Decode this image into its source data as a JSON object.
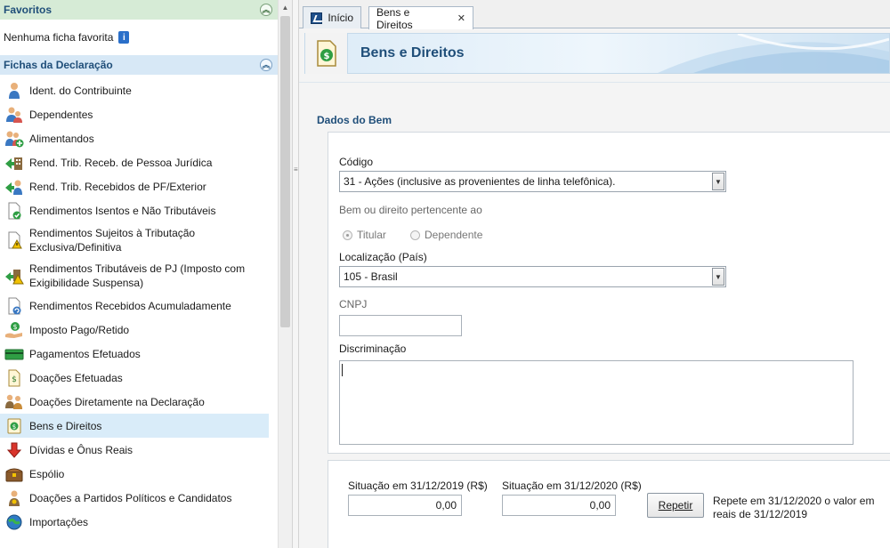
{
  "sidebar": {
    "favoritos": {
      "title": "Favoritos",
      "empty_text": "Nenhuma ficha favorita"
    },
    "fichas": {
      "title": "Fichas da Declaração",
      "items": [
        {
          "label": "Ident. do Contribuinte",
          "icon": "person-icon"
        },
        {
          "label": "Dependentes",
          "icon": "dependents-icon"
        },
        {
          "label": "Alimentandos",
          "icon": "alimentandos-icon"
        },
        {
          "label": "Rend. Trib. Receb. de Pessoa Jurídica",
          "icon": "pj-income-icon"
        },
        {
          "label": "Rend. Trib. Recebidos de PF/Exterior",
          "icon": "pf-income-icon"
        },
        {
          "label": "Rendimentos Isentos e Não Tributáveis",
          "icon": "exempt-income-icon"
        },
        {
          "label": "Rendimentos Sujeitos à Tributação Exclusiva/Definitiva",
          "icon": "exclusive-tax-icon"
        },
        {
          "label": "Rendimentos Tributáveis de PJ (Imposto com Exigibilidade Suspensa)",
          "icon": "suspended-tax-icon"
        },
        {
          "label": "Rendimentos Recebidos Acumuladamente",
          "icon": "accumulated-income-icon"
        },
        {
          "label": "Imposto Pago/Retido",
          "icon": "tax-paid-icon"
        },
        {
          "label": "Pagamentos Efetuados",
          "icon": "payments-icon"
        },
        {
          "label": "Doações Efetuadas",
          "icon": "donations-icon"
        },
        {
          "label": "Doações Diretamente na Declaração",
          "icon": "direct-donations-icon"
        },
        {
          "label": "Bens e Direitos",
          "icon": "assets-icon"
        },
        {
          "label": "Dívidas e Ônus Reais",
          "icon": "debts-icon"
        },
        {
          "label": "Espólio",
          "icon": "estate-icon"
        },
        {
          "label": "Doações a Partidos Políticos e Candidatos",
          "icon": "political-donations-icon"
        },
        {
          "label": "Importações",
          "icon": "imports-icon"
        }
      ]
    }
  },
  "tabs": [
    {
      "label": "Início"
    },
    {
      "label": "Bens e Direitos"
    }
  ],
  "page": {
    "title": "Bens e Direitos"
  },
  "form": {
    "section_title": "Dados do Bem",
    "codigo_label": "Código",
    "codigo_value": "31 - Ações (inclusive as provenientes de linha telefônica).",
    "pertencente_label": "Bem ou direito pertencente ao",
    "titular_label": "Titular",
    "dependente_label": "Dependente",
    "localizacao_label": "Localização (País)",
    "localizacao_value": "105 - Brasil",
    "cnpj_label": "CNPJ",
    "cnpj_value": "",
    "discriminacao_label": "Discriminação",
    "sit2019_label": "Situação em 31/12/2019 (R$)",
    "sit2019_value": "0,00",
    "sit2020_label": "Situação em 31/12/2020 (R$)",
    "sit2020_value": "0,00",
    "repetir_label": "Repetir",
    "repetir_note": "Repete em 31/12/2020 o valor em reais de 31/12/2019"
  },
  "colors": {
    "accent_blue": "#1f4e79",
    "selected_row": "#d9ecf9",
    "favorites_header": "#d6ebd6",
    "fichas_header": "#d7e8f6"
  }
}
